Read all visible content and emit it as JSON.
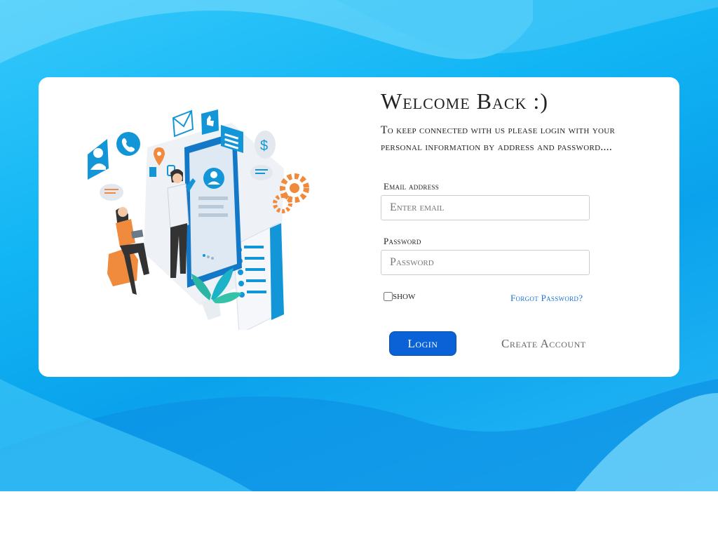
{
  "login": {
    "title": "Welcome Back :)",
    "subtitle": "To keep connected with us please login with your personal information by address and password....",
    "email_label": "Email address",
    "email_placeholder": "Enter email",
    "email_value": "",
    "password_label": "Password",
    "password_placeholder": "Password",
    "password_value": "",
    "show_label": "show",
    "show_checked": false,
    "forgot_label": "Forgot Password?",
    "login_label": "Login",
    "create_account_label": "Create Account"
  },
  "colors": {
    "background": "#12b5f4",
    "primary_button": "#0b62d6",
    "link": "#1a73d8",
    "illustration_blue": "#1296d8",
    "illustration_orange": "#f08a3c"
  },
  "illustration": {
    "icons": [
      "user-profile-icon",
      "phone-icon",
      "mail-icon",
      "thumbs-up-icon",
      "document-icon",
      "dollar-icon",
      "location-pin-icon",
      "chat-bubble-icon",
      "gear-icon"
    ]
  }
}
